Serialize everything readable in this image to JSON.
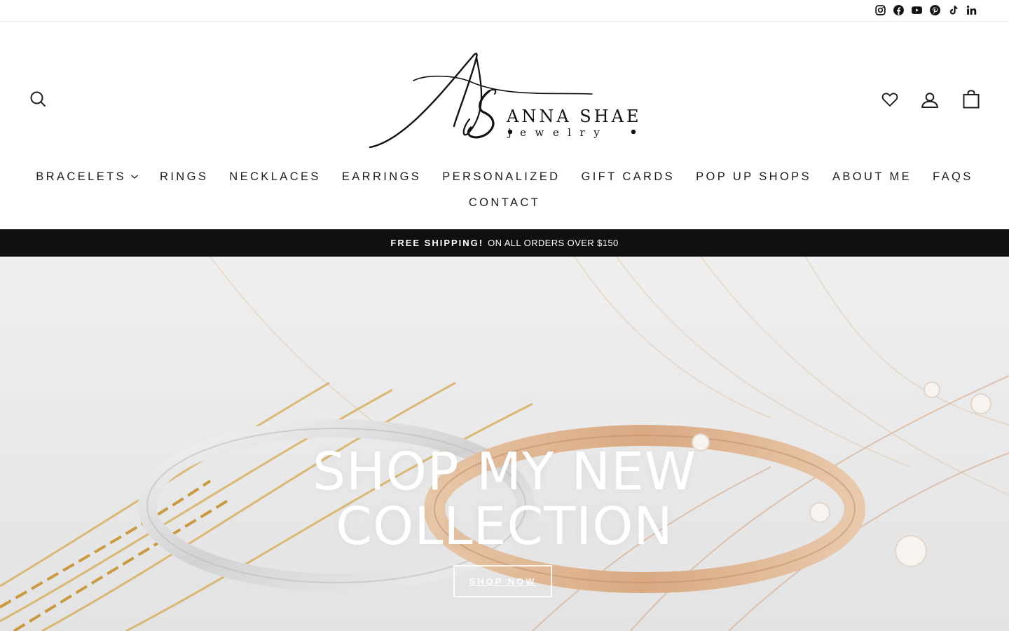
{
  "social": {
    "items": [
      {
        "name": "Instagram",
        "icon": "instagram-icon"
      },
      {
        "name": "Facebook",
        "icon": "facebook-icon"
      },
      {
        "name": "YouTube",
        "icon": "youtube-icon"
      },
      {
        "name": "Pinterest",
        "icon": "pinterest-icon"
      },
      {
        "name": "TikTok",
        "icon": "tiktok-icon"
      },
      {
        "name": "LinkedIn",
        "icon": "linkedin-icon"
      }
    ]
  },
  "brand": {
    "monogram": "AS",
    "name": "ANNA SHAE",
    "tagline": "jewelry"
  },
  "header_icons": {
    "search": "search-icon",
    "wishlist": "heart-icon",
    "account": "user-icon",
    "cart": "bag-icon"
  },
  "nav": {
    "row1": [
      "BRACELETS",
      "RINGS",
      "NECKLACES",
      "EARRINGS",
      "PERSONALIZED",
      "GIFT CARDS",
      "POP UP SHOPS",
      "ABOUT ME",
      "FAQS"
    ],
    "row2": [
      "CONTACT"
    ],
    "dropdown_item": "BRACELETS"
  },
  "announcement": {
    "strong": "FREE SHIPPING!",
    "text": "ON ALL ORDERS OVER $150"
  },
  "hero": {
    "title_line1": "SHOP MY NEW",
    "title_line2": "COLLECTION",
    "button_label": "SHOP NOW"
  },
  "colors": {
    "text": "#1c1d1d",
    "announcement_bg": "#0f0f0f",
    "white": "#ffffff"
  }
}
